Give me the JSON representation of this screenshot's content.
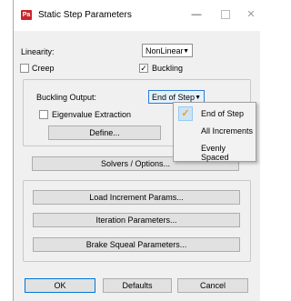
{
  "window": {
    "icon_text": "Pa",
    "title": "Static Step Parameters",
    "minimize": "—",
    "close": "✕"
  },
  "linearity": {
    "label": "Linearity:",
    "value": "NonLinear"
  },
  "creep": {
    "label": "Creep",
    "checked": false
  },
  "buckling": {
    "label": "Buckling",
    "checked": true
  },
  "buckling_output": {
    "label": "Buckling Output:",
    "value": "End of Step"
  },
  "eigen": {
    "label": "Eigenvalue Extraction",
    "checked": false
  },
  "define_button": "Define...",
  "solvers_button": "Solvers / Options...",
  "load_increment_button": "Load Increment Params...",
  "iteration_button": "Iteration Parameters...",
  "brake_squeal_button": "Brake Squeal Parameters...",
  "footer": {
    "ok": "OK",
    "defaults": "Defaults",
    "cancel": "Cancel"
  },
  "dropdown_options": [
    {
      "label": "End of Step",
      "selected": true
    },
    {
      "label": "All Increments",
      "selected": false
    },
    {
      "label": "Evenly Spaced",
      "selected": false
    }
  ],
  "check_glyph": "✓",
  "colors": {
    "focus": "#2a7ad8",
    "check": "#f0a010",
    "icon": "#c8252c"
  }
}
